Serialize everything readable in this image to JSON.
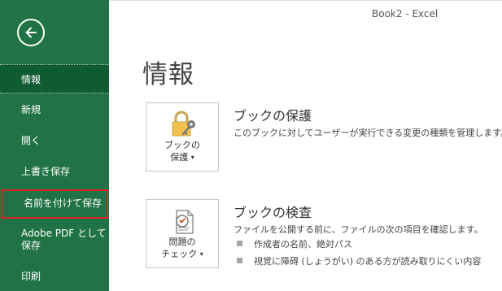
{
  "window": {
    "title": "Book2  -  Excel"
  },
  "sidebar": {
    "back_icon": "back-arrow-icon",
    "items": [
      {
        "label": "情報",
        "active": true
      },
      {
        "label": "新規"
      },
      {
        "label": "開く"
      },
      {
        "label": "上書き保存"
      },
      {
        "label": "名前を付けて保存",
        "highlighted": true
      },
      {
        "label": "Adobe PDF として",
        "label2": "保存"
      },
      {
        "label": "印刷"
      }
    ]
  },
  "main": {
    "title": "情報",
    "protect": {
      "button_line1": "ブックの",
      "button_line2": "保護",
      "icon": "lock-key-icon",
      "heading": "ブックの保護",
      "description": "このブックに対してユーザーが実行できる変更の種類を管理します。"
    },
    "inspect": {
      "button_line1": "問題の",
      "button_line2": "チェック",
      "icon": "inspect-document-icon",
      "heading": "ブックの検査",
      "description": "ファイルを公開する前に、ファイルの次の項目を確認します。",
      "bullets": [
        "作成者の名前、絶対パス",
        "視覚に障碍 (しょうがい) のある方が読み取りにくい内容"
      ]
    }
  },
  "colors": {
    "sidebar": "#217346",
    "active": "#0f5b32",
    "highlight_border": "#e02424"
  }
}
